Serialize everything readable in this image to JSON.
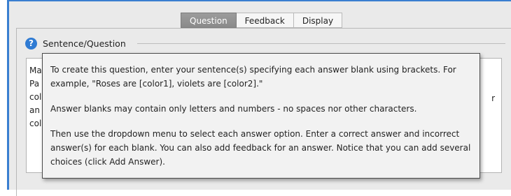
{
  "tabs": [
    {
      "label": "Question",
      "active": true
    },
    {
      "label": "Feedback",
      "active": false
    },
    {
      "label": "Display",
      "active": false
    }
  ],
  "section": {
    "title": "Sentence/Question",
    "help_icon": "help-question-icon"
  },
  "editor": {
    "visible_line_fragments": [
      "Ma",
      "Pa",
      "col",
      "an",
      "col"
    ],
    "right_fragment": "r"
  },
  "tooltip": {
    "paragraphs": [
      "To create this question, enter your sentence(s) specifying each answer blank using brackets. For example, \"Roses are [color1], violets are [color2].\"",
      "Answer blanks may contain only letters and numbers - no spaces nor other characters.",
      "Then use the dropdown menu to select each answer option. Enter a correct answer and incorrect answer(s) for each blank. You can also add feedback for an answer. Notice that you can add several choices (click Add Answer)."
    ]
  },
  "colors": {
    "accent_blue": "#3a7fd0",
    "help_icon_blue": "#2f7bd3",
    "active_tab_gray": "#8f8f8f",
    "panel_background": "#eaeaea",
    "tooltip_background": "#f2f2f2"
  }
}
